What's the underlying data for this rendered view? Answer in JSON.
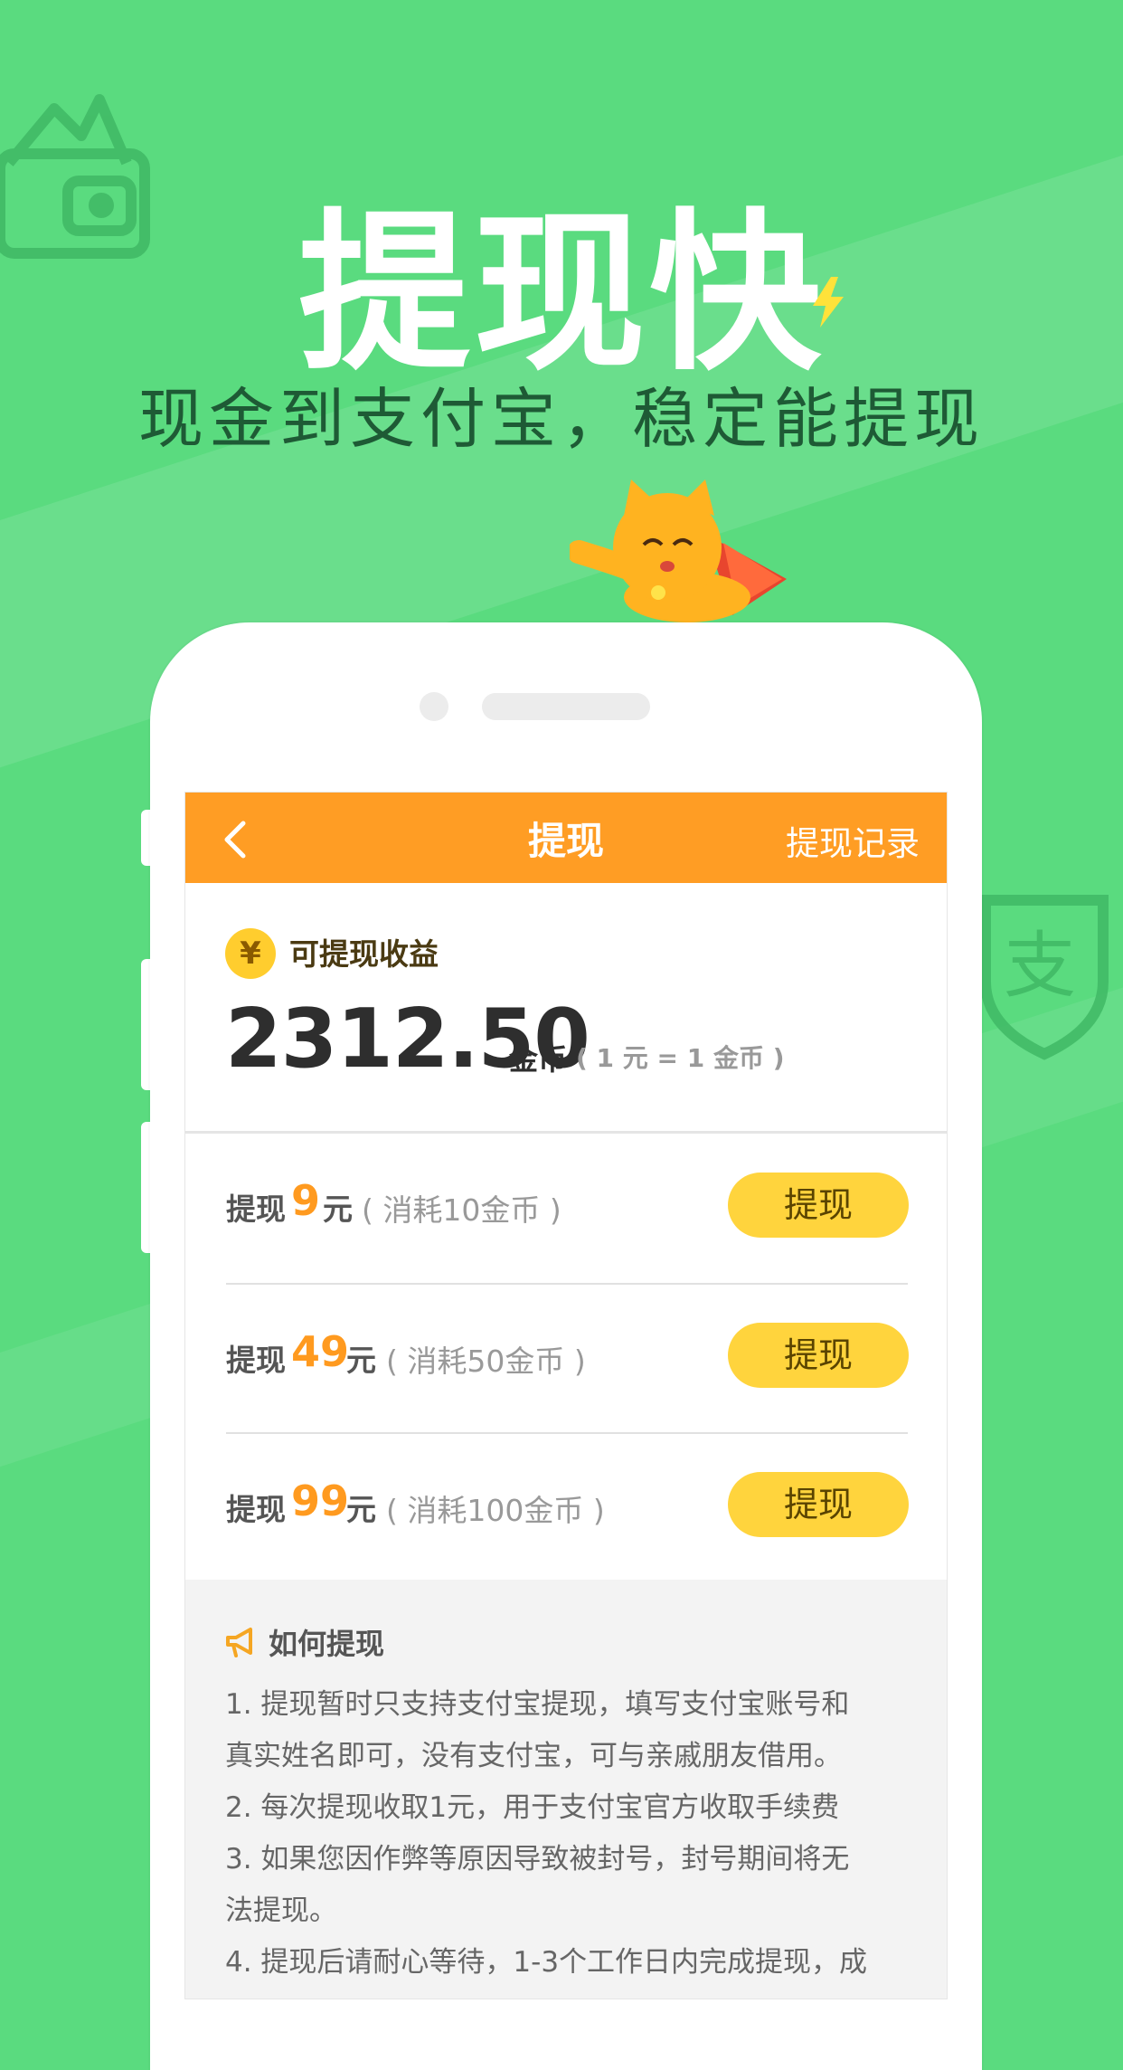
{
  "hero": {
    "title": "提现快",
    "subtitle": "现金到支付宝，稳定能提现"
  },
  "colors": {
    "background": "#5ADB7F",
    "topbar": "#FF9D24",
    "accent_amount": "#FF9A1F",
    "button": "#FFD43D"
  },
  "icons": [
    "wallet-icon",
    "alipay-shield-icon",
    "lightning-icon",
    "cat-mascot",
    "back-icon",
    "yen-icon",
    "megaphone-icon"
  ],
  "topbar": {
    "title": "提现",
    "right_link": "提现记录"
  },
  "earnings": {
    "label": "可提现收益",
    "yen_symbol": "¥",
    "amount": "2312.50",
    "unit": "金币",
    "rate": "( 1 元 = 1 金币 )"
  },
  "options": [
    {
      "prefix": "提现",
      "amount": "9",
      "suffix": "元",
      "cost": "( 消耗10金币 )",
      "button": "提现"
    },
    {
      "prefix": "提现",
      "amount": "49",
      "suffix": "元",
      "cost": "( 消耗50金币 )",
      "button": "提现"
    },
    {
      "prefix": "提现",
      "amount": "99",
      "suffix": "元",
      "cost": "( 消耗100金币 )",
      "button": "提现"
    }
  ],
  "howto": {
    "title": "如何提现",
    "lines": [
      "1. 提现暂时只支持支付宝提现，填写支付宝账号和",
      "真实姓名即可，没有支付宝，可与亲戚朋友借用。",
      "2. 每次提现收取1元，用于支付宝官方收取手续费",
      "3. 如果您因作弊等原因导致被封号，封号期间将无",
      "法提现。",
      "4. 提现后请耐心等待，1-3个工作日内完成提现，成"
    ]
  }
}
